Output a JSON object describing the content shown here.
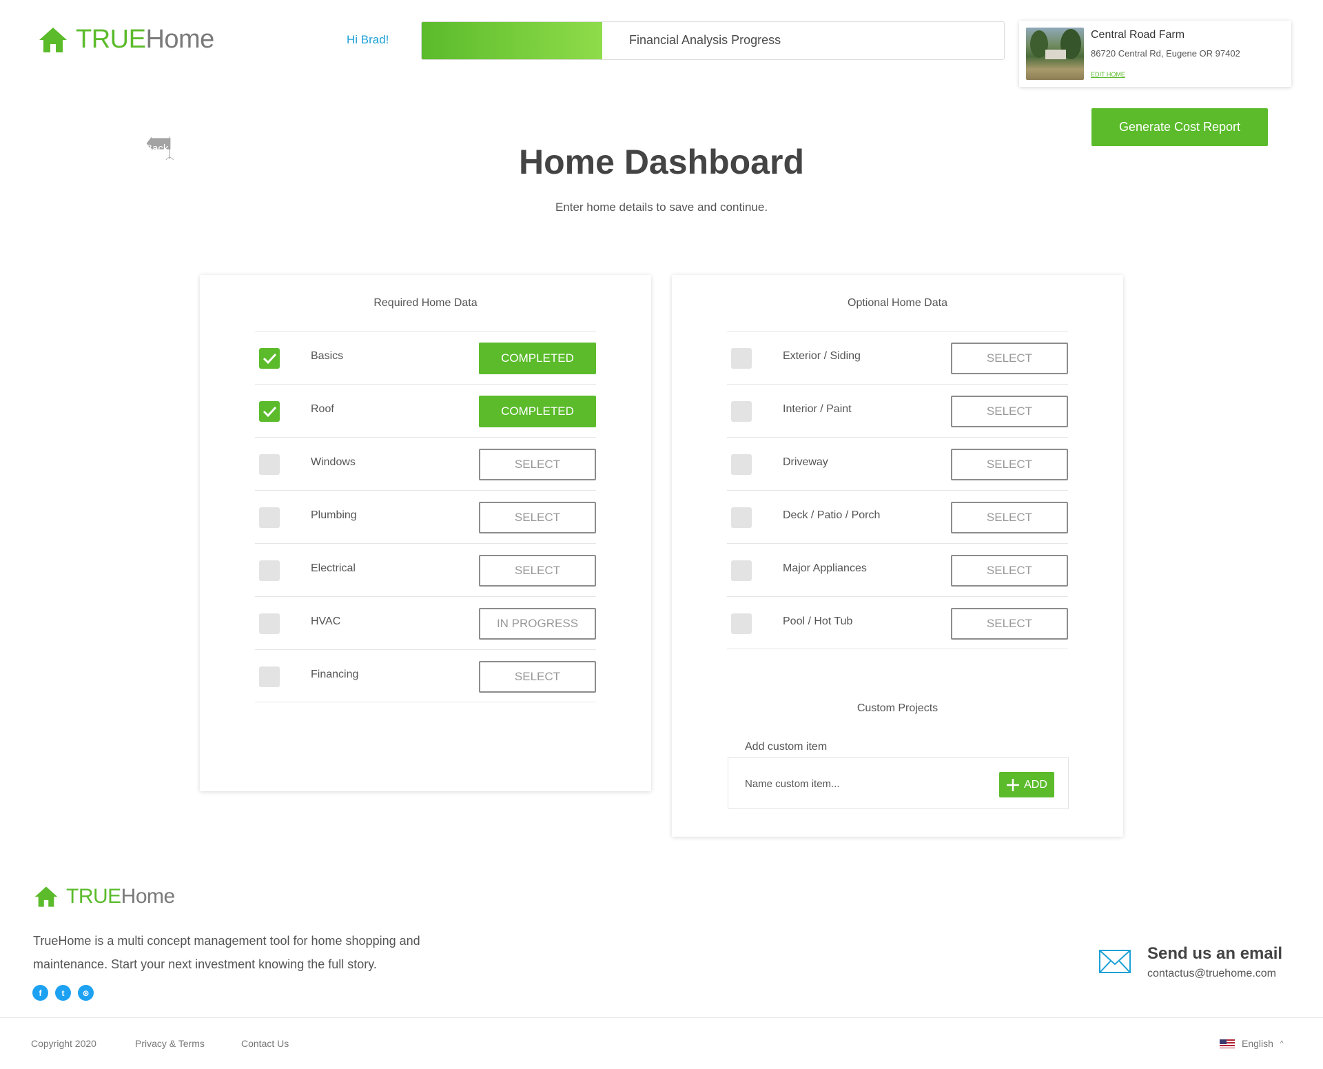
{
  "brand": {
    "part1": "TRUE",
    "part2": "Home",
    "accent_color": "#5bbb2b"
  },
  "header": {
    "greeting": "Hi Brad!",
    "progress": {
      "label": "Financial Analysis Progress",
      "fraction": 0.31
    },
    "home": {
      "name": "Central Road Farm",
      "address": "86720 Central Rd, Eugene OR 97402",
      "edit": "EDIT HOME"
    },
    "report_button": "Generate Cost Report",
    "back": "Back"
  },
  "main": {
    "title": "Home Dashboard",
    "subtitle": "Enter home details to save and continue."
  },
  "required": {
    "heading": "Required Home Data",
    "items": [
      {
        "label": "Basics",
        "status": "COMPLETED",
        "checked": true
      },
      {
        "label": "Roof",
        "status": "COMPLETED",
        "checked": true
      },
      {
        "label": "Windows",
        "status": "SELECT",
        "checked": false
      },
      {
        "label": "Plumbing",
        "status": "SELECT",
        "checked": false
      },
      {
        "label": "Electrical",
        "status": "SELECT",
        "checked": false
      },
      {
        "label": "HVAC",
        "status": "IN PROGRESS",
        "checked": false
      },
      {
        "label": "Financing",
        "status": "SELECT",
        "checked": false
      }
    ]
  },
  "optional": {
    "heading": "Optional Home Data",
    "items": [
      {
        "label": "Exterior / Siding",
        "status": "SELECT",
        "checked": false
      },
      {
        "label": "Interior / Paint",
        "status": "SELECT",
        "checked": false
      },
      {
        "label": "Driveway",
        "status": "SELECT",
        "checked": false
      },
      {
        "label": "Deck / Patio / Porch",
        "status": "SELECT",
        "checked": false
      },
      {
        "label": "Major Appliances",
        "status": "SELECT",
        "checked": false
      },
      {
        "label": "Pool / Hot Tub",
        "status": "SELECT",
        "checked": false
      }
    ],
    "custom": {
      "heading": "Custom Projects",
      "label": "Add custom item",
      "placeholder": "Name custom item...",
      "add_button": "ADD"
    }
  },
  "footer": {
    "description": "TrueHome is a multi concept management tool for home shopping and maintenance. Start your next investment knowing the full story.",
    "social": [
      {
        "icon": "facebook-icon",
        "glyph": "f"
      },
      {
        "icon": "twitter-icon",
        "glyph": "t"
      },
      {
        "icon": "dribbble-icon",
        "glyph": "⊛"
      }
    ],
    "email_title": "Send us an email",
    "email": "contactus@truehome.com",
    "copyright": "Copyright 2020",
    "privacy": "Privacy & Terms",
    "contact": "Contact Us",
    "language": "English"
  }
}
